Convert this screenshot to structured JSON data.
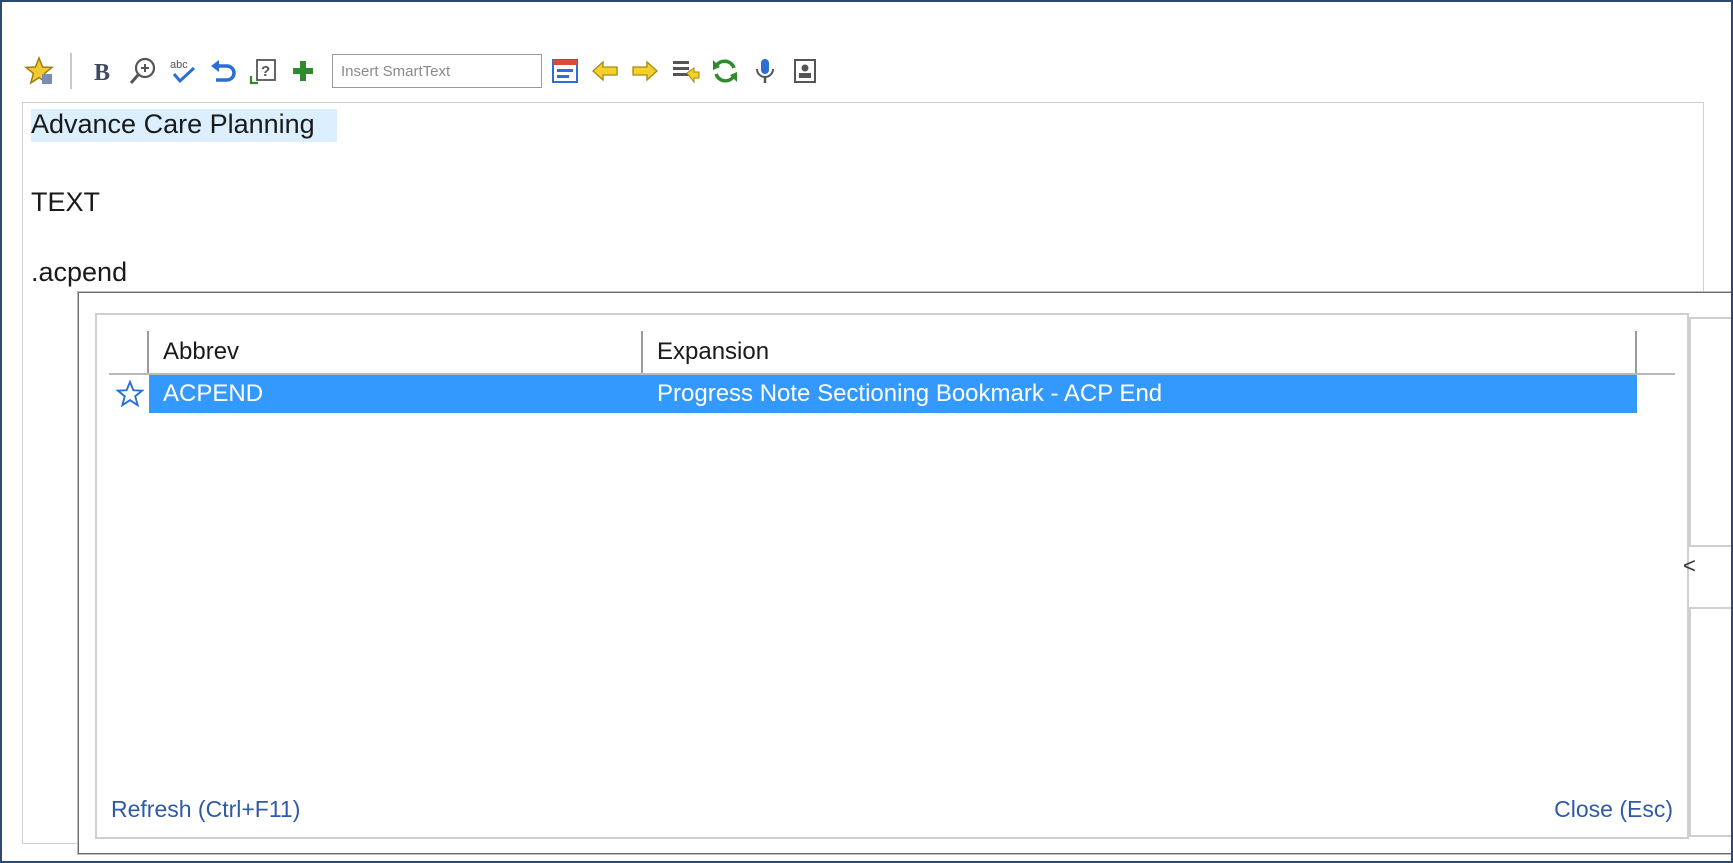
{
  "toolbar": {
    "icons": [
      "favorite-star-icon",
      "bold-icon",
      "zoom-icon",
      "spell-check-icon",
      "undo-icon",
      "help-icon",
      "add-icon",
      "smarttext-list-icon",
      "previous-arrow-icon",
      "next-arrow-icon",
      "insert-list-icon",
      "refresh-icon",
      "microphone-icon",
      "contact-card-icon"
    ],
    "smarttext_placeholder": "Insert SmartText",
    "colors": {
      "accent_green": "#2e8b2e",
      "arrow_yellow": "#e0b400",
      "undo_blue": "#2a6fd6",
      "selection_blue": "#3399ff",
      "link_blue": "#2f5aa8"
    }
  },
  "editor": {
    "lines": [
      "Advance Care Planning",
      "TEXT",
      ".acpend"
    ]
  },
  "popup": {
    "columns": {
      "abbrev": "Abbrev",
      "expansion": "Expansion"
    },
    "rows": [
      {
        "abbrev": "ACPEND",
        "expansion": "Progress Note Sectioning Bookmark - ACP End",
        "selected": true
      }
    ],
    "refresh_label": "Refresh (Ctrl+F11)",
    "close_label": "Close (Esc)",
    "side_mark": "<"
  }
}
